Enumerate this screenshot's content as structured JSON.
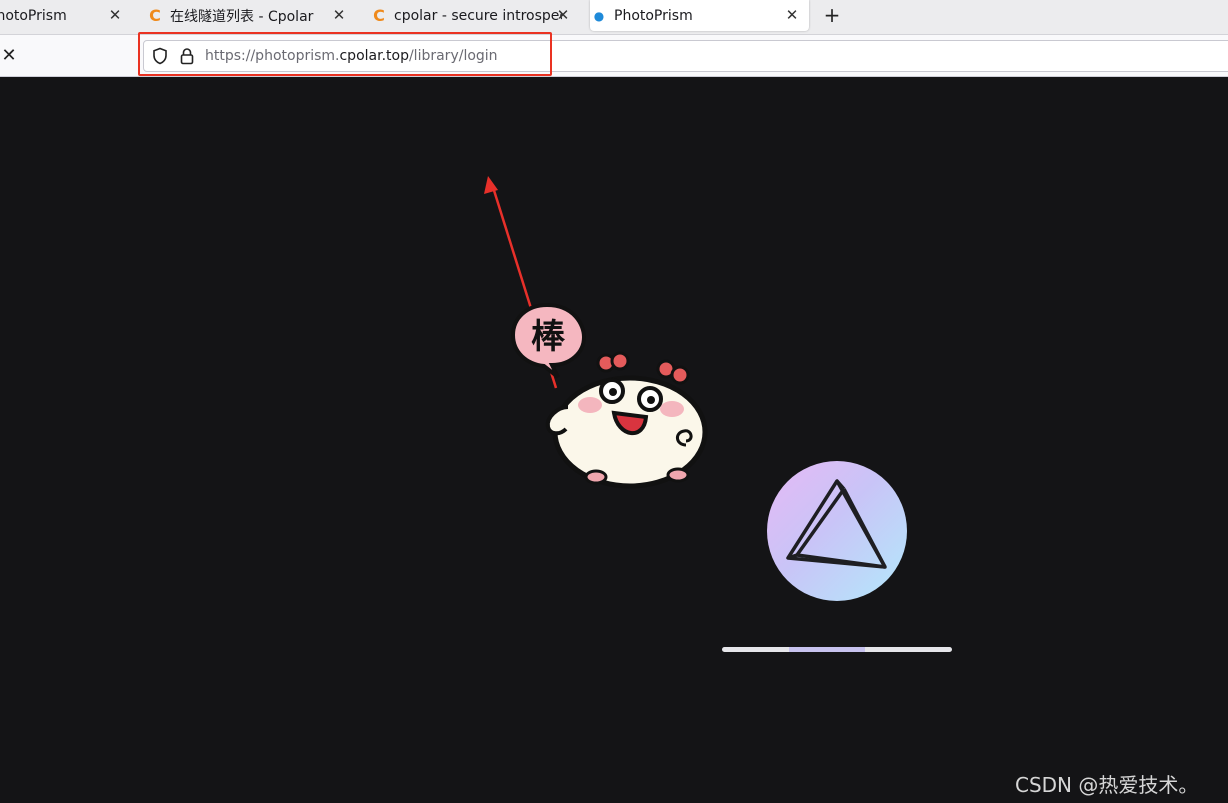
{
  "browser": {
    "tabs": [
      {
        "title": "PhotoPrism",
        "favicon": "dot-icon"
      },
      {
        "title": "在线隧道列表 - Cpolar",
        "favicon": "cpolar-c-icon"
      },
      {
        "title": "cpolar - secure introspect",
        "favicon": "cpolar-c-icon"
      },
      {
        "title": "PhotoPrism",
        "favicon": "dot-icon",
        "active": true
      }
    ],
    "new_tab_label": "+",
    "url": {
      "prefix": "https://photoprism.",
      "host": "cpolar.top",
      "path": "/library/login"
    }
  },
  "page": {
    "logo": "photoprism-prism-icon",
    "loading_progress": 0.33,
    "accent_colors": [
      "#e6b9f5",
      "#b3e9fb"
    ]
  },
  "annotation": {
    "highlight_color": "#ea3222",
    "sticker_text": "棒"
  },
  "watermark": "CSDN @热爱技术。"
}
